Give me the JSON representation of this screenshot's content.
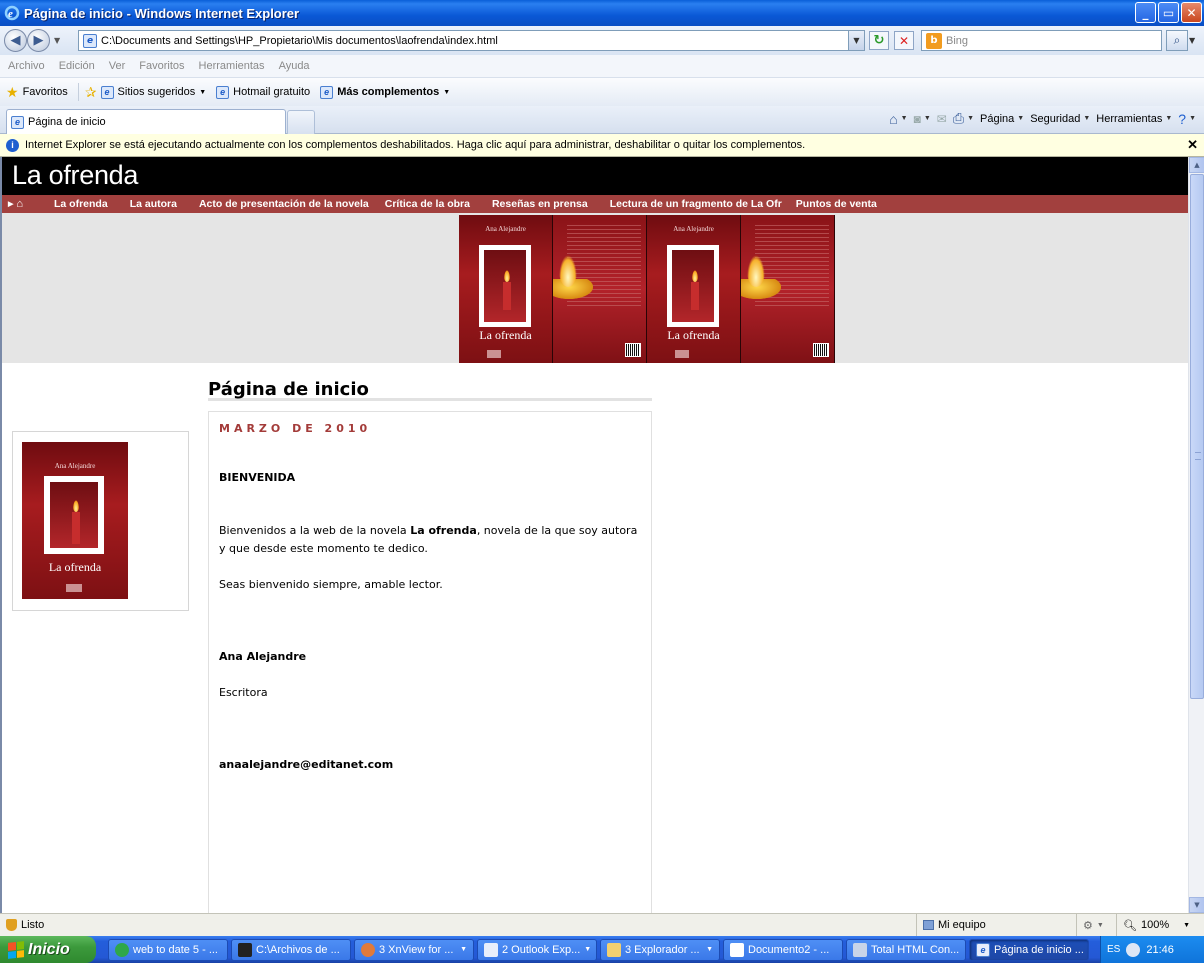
{
  "window": {
    "title": "Página de inicio - Windows Internet Explorer",
    "minimize": "_",
    "maximize": "▭",
    "close": "✕"
  },
  "address_bar": {
    "url": "C:\\Documents and Settings\\HP_Propietario\\Mis documentos\\laofrenda\\index.html",
    "search_placeholder": "Bing"
  },
  "menu": [
    "Archivo",
    "Edición",
    "Ver",
    "Favoritos",
    "Herramientas",
    "Ayuda"
  ],
  "favorites_bar": {
    "favorites": "Favoritos",
    "items": [
      "Sitios sugeridos",
      "Hotmail gratuito",
      "Más complementos"
    ]
  },
  "tab": {
    "label": "Página de inicio"
  },
  "command_bar": {
    "page": "Página",
    "security": "Seguridad",
    "tools": "Herramientas"
  },
  "info_bar": {
    "message": "Internet Explorer se está ejecutando actualmente con los complementos deshabilitados. Haga clic aquí para administrar, deshabilitar o quitar los complementos."
  },
  "site": {
    "title": "La ofrenda",
    "nav": [
      "La ofrenda",
      "La autora",
      "Acto de presentación de la novela",
      "Crítica de la obra",
      "Reseñas en prensa",
      "Lectura de un fragmento de La Ofr",
      "Puntos de venta"
    ],
    "cover": {
      "author": "Ana Alejandre",
      "title": "La ofrenda"
    }
  },
  "content": {
    "heading": "Página de inicio",
    "post": {
      "date": "MARZO DE 2010",
      "welcome": "BIENVENIDA",
      "body_before": "Bienvenidos a la web de la novela ",
      "body_bold": "La ofrenda",
      "body_after": ", novela de la que soy autora y que desde este momento te dedico.",
      "bye": "Seas bienvenido siempre, amable lector.",
      "author": "Ana Alejandre",
      "role": "Escritora",
      "email": "anaalejandre@editanet.com"
    }
  },
  "status_bar": {
    "status": "Listo",
    "zone": "Mi equipo",
    "zoom": "100%"
  },
  "taskbar": {
    "start": "Inicio",
    "tasks": [
      "web to date 5 - ...",
      "C:\\Archivos de ...",
      "3 XnView for ...",
      "2 Outlook Exp...",
      "3 Explorador ...",
      "Documento2 - ...",
      "Total HTML Con...",
      "Página de inicio ..."
    ],
    "lang": "ES",
    "time": "21:46"
  }
}
